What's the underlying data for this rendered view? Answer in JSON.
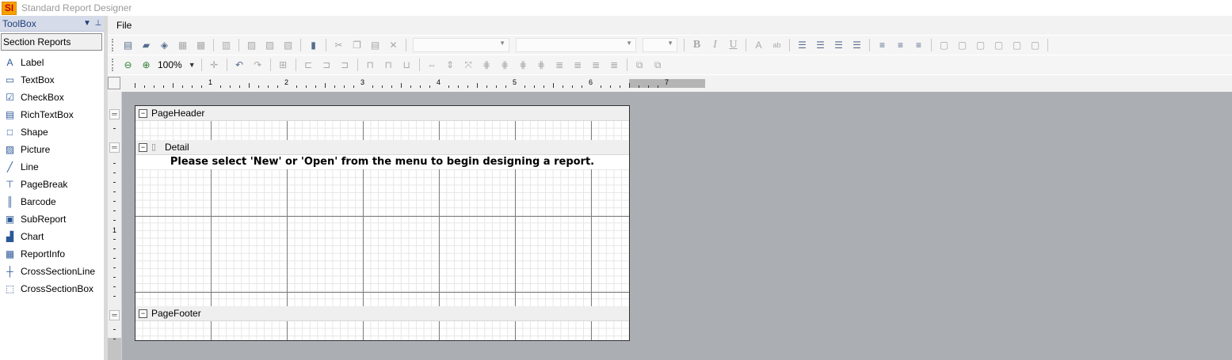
{
  "window": {
    "app_icon_text": "SI",
    "title": "Standard Report Designer"
  },
  "toolbox": {
    "header": "ToolBox",
    "group": "Section Reports",
    "items": [
      {
        "label": "Label",
        "icon": "label-icon"
      },
      {
        "label": "TextBox",
        "icon": "textbox-icon"
      },
      {
        "label": "CheckBox",
        "icon": "checkbox-icon"
      },
      {
        "label": "RichTextBox",
        "icon": "richtextbox-icon"
      },
      {
        "label": "Shape",
        "icon": "shape-icon"
      },
      {
        "label": "Picture",
        "icon": "picture-icon"
      },
      {
        "label": "Line",
        "icon": "line-icon"
      },
      {
        "label": "PageBreak",
        "icon": "pagebreak-icon"
      },
      {
        "label": "Barcode",
        "icon": "barcode-icon"
      },
      {
        "label": "SubReport",
        "icon": "subreport-icon"
      },
      {
        "label": "Chart",
        "icon": "chart-icon"
      },
      {
        "label": "ReportInfo",
        "icon": "reportinfo-icon"
      },
      {
        "label": "CrossSectionLine",
        "icon": "crosssectionline-icon"
      },
      {
        "label": "CrossSectionBox",
        "icon": "crosssectionbox-icon"
      }
    ]
  },
  "menu": {
    "file": "File"
  },
  "toolbar": {
    "zoom": "100%"
  },
  "ruler": {
    "numbers": [
      "1",
      "2",
      "3",
      "4",
      "5",
      "6",
      "7"
    ],
    "vertical_numbers": [
      "1"
    ]
  },
  "report": {
    "sections": {
      "page_header": "PageHeader",
      "detail": "Detail",
      "page_footer": "PageFooter"
    },
    "message": "Please select 'New' or 'Open' from the menu to begin designing a report."
  }
}
